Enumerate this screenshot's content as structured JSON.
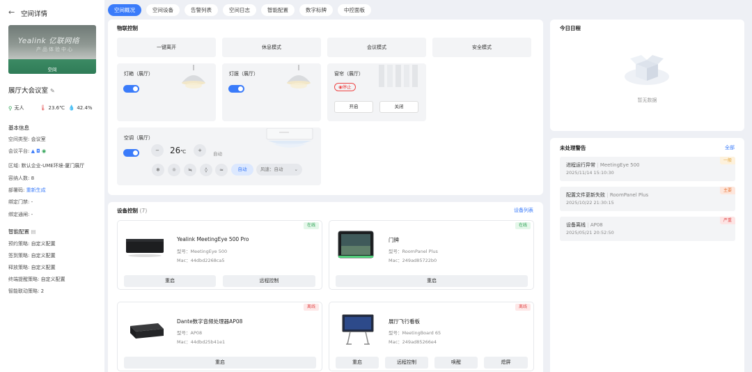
{
  "left_panel": {
    "back_icon": "arrow-left-icon",
    "title": "空间详情",
    "photo_sign": "Yealink 亿联网络",
    "photo_sign2": "产品体验中心",
    "photo_tag": "空间",
    "room_name": "展厅大会议室",
    "stats": {
      "occupancy": "无人",
      "temperature": "23.6℃",
      "humidity": "42.4%"
    },
    "basic_info_title": "基本信息",
    "basic_info": [
      {
        "label": "空间类型:",
        "value": "会议室"
      },
      {
        "label": "会议平台:",
        "value": ""
      },
      {
        "label": "区域:",
        "value": "默认企业-UME环境-厦门展厅"
      },
      {
        "label": "容纳人数:",
        "value": "8"
      },
      {
        "label": "部署码:",
        "value": "重新生成"
      },
      {
        "label": "绑定门禁:",
        "value": "-"
      },
      {
        "label": "绑定通闸:",
        "value": "-"
      }
    ],
    "smart_config_title": "智能配置",
    "smart_config": [
      {
        "label": "预约策略:",
        "value": "自定义配置"
      },
      {
        "label": "签到策略:",
        "value": "自定义配置"
      },
      {
        "label": "释放策略:",
        "value": "自定义配置"
      },
      {
        "label": "终端提醒策略:",
        "value": "自定义配置"
      },
      {
        "label": "智能联动策略:",
        "value": "2"
      }
    ]
  },
  "tabs": [
    {
      "label": "空间概况",
      "active": true
    },
    {
      "label": "空间设备",
      "active": false
    },
    {
      "label": "告警列表",
      "active": false
    },
    {
      "label": "空间日志",
      "active": false
    },
    {
      "label": "智能配置",
      "active": false
    },
    {
      "label": "数字标牌",
      "active": false
    },
    {
      "label": "中控面板",
      "active": false
    }
  ],
  "iot": {
    "title": "物联控制",
    "presets": [
      "一键离开",
      "休息模式",
      "会议模式",
      "安全模式"
    ],
    "lamp_box": {
      "name": "灯箱（展厅）",
      "on": true
    },
    "lamp_strip": {
      "name": "灯膜（展厅）",
      "on": true
    },
    "curtain": {
      "name": "窗帘（展厅）",
      "state": "停止",
      "open": "开启",
      "close": "关闭"
    },
    "ac": {
      "name": "空调（展厅）",
      "on": true,
      "temp": "26",
      "unit": "℃",
      "minus": "−",
      "plus": "+",
      "mode_label": "自动",
      "modes": [
        "snowflake-icon",
        "sun-icon",
        "dehumidify-icon",
        "drop-icon",
        "wind-icon"
      ],
      "mode_active": "自动",
      "fan_label": "风速：自动"
    }
  },
  "devices": {
    "title": "设备控制",
    "count": "(7)",
    "list_link": "设备列表",
    "items": [
      {
        "name": "Yealink MeetingEye 500 Pro",
        "model": "型号：MeetingEye 500",
        "mac": "Mac：44dbd2268ca5",
        "status": "在线",
        "buttons": [
          "重启",
          "远程控制"
        ]
      },
      {
        "name": "门牌",
        "model": "型号：RoomPanel Plus",
        "mac": "Mac：249ad85722b0",
        "status": "在线",
        "buttons": [
          "重启"
        ]
      },
      {
        "name": "Dante数字音频处理器AP08",
        "model": "型号：AP08",
        "mac": "Mac：44dbd25b41e1",
        "status": "离线",
        "buttons": [
          "重启"
        ]
      },
      {
        "name": "展厅飞行看板",
        "model": "型号：MeetingBoard 65",
        "mac": "Mac：249ad85266e4",
        "status": "离线",
        "buttons": [
          "重启",
          "远程控制",
          "唤醒",
          "熄屏"
        ]
      }
    ]
  },
  "schedule": {
    "title": "今日日程",
    "empty": "暂无数据"
  },
  "alerts": {
    "title": "未处理警告",
    "all_link": "全部",
    "items": [
      {
        "title": "进程运行异常",
        "device": "MeetingEye 500",
        "time": "2025/11/14 15:10:30",
        "level": "一般"
      },
      {
        "title": "配置文件更新失败",
        "device": "RoomPanel Plus",
        "time": "2025/10/22 21:30:15",
        "level": "主要"
      },
      {
        "title": "设备离线",
        "device": "AP08",
        "time": "2025/05/21 20:52:50",
        "level": "严重"
      }
    ]
  },
  "colors": {
    "accent": "#3a7bfa",
    "online": "#2aa052",
    "offline": "#e14b4b"
  }
}
